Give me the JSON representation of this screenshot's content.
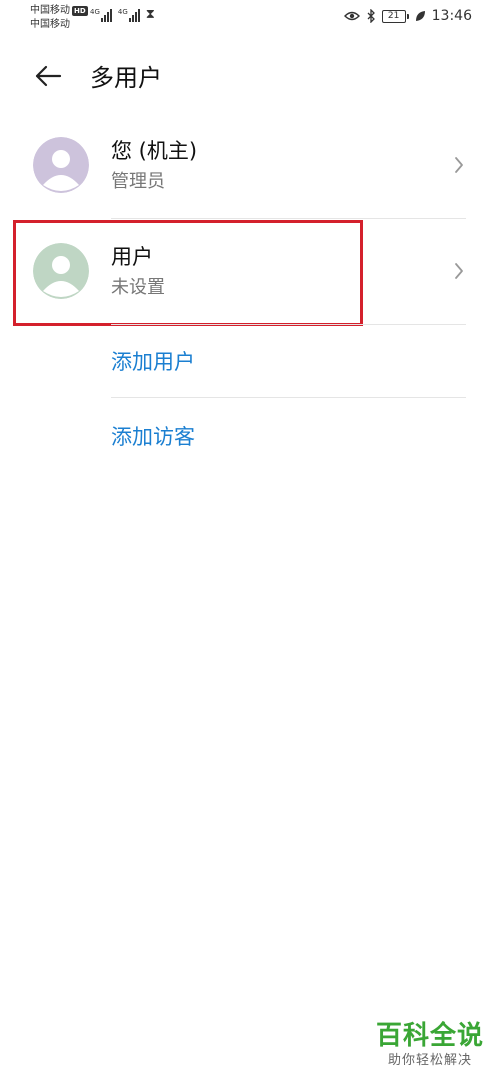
{
  "status_bar": {
    "carrier_1": "中国移动",
    "hd_badge": "HD",
    "carrier_2": "中国移动",
    "net_1": "4G",
    "net_2": "4G",
    "battery_level": "21",
    "time": "13:46"
  },
  "header": {
    "title": "多用户"
  },
  "users": [
    {
      "name": "您 (机主)",
      "role": "管理员",
      "avatar_color": "#cdc3dc"
    },
    {
      "name": "用户",
      "role": "未设置",
      "avatar_color": "#bfd6c4"
    }
  ],
  "actions": {
    "add_user": "添加用户",
    "add_guest": "添加访客"
  },
  "colors": {
    "link": "#1b7fd1",
    "highlight": "#d4202c",
    "watermark": "#3aa635"
  },
  "watermark": {
    "title": "百科全说",
    "subtitle": "助你轻松解决"
  }
}
